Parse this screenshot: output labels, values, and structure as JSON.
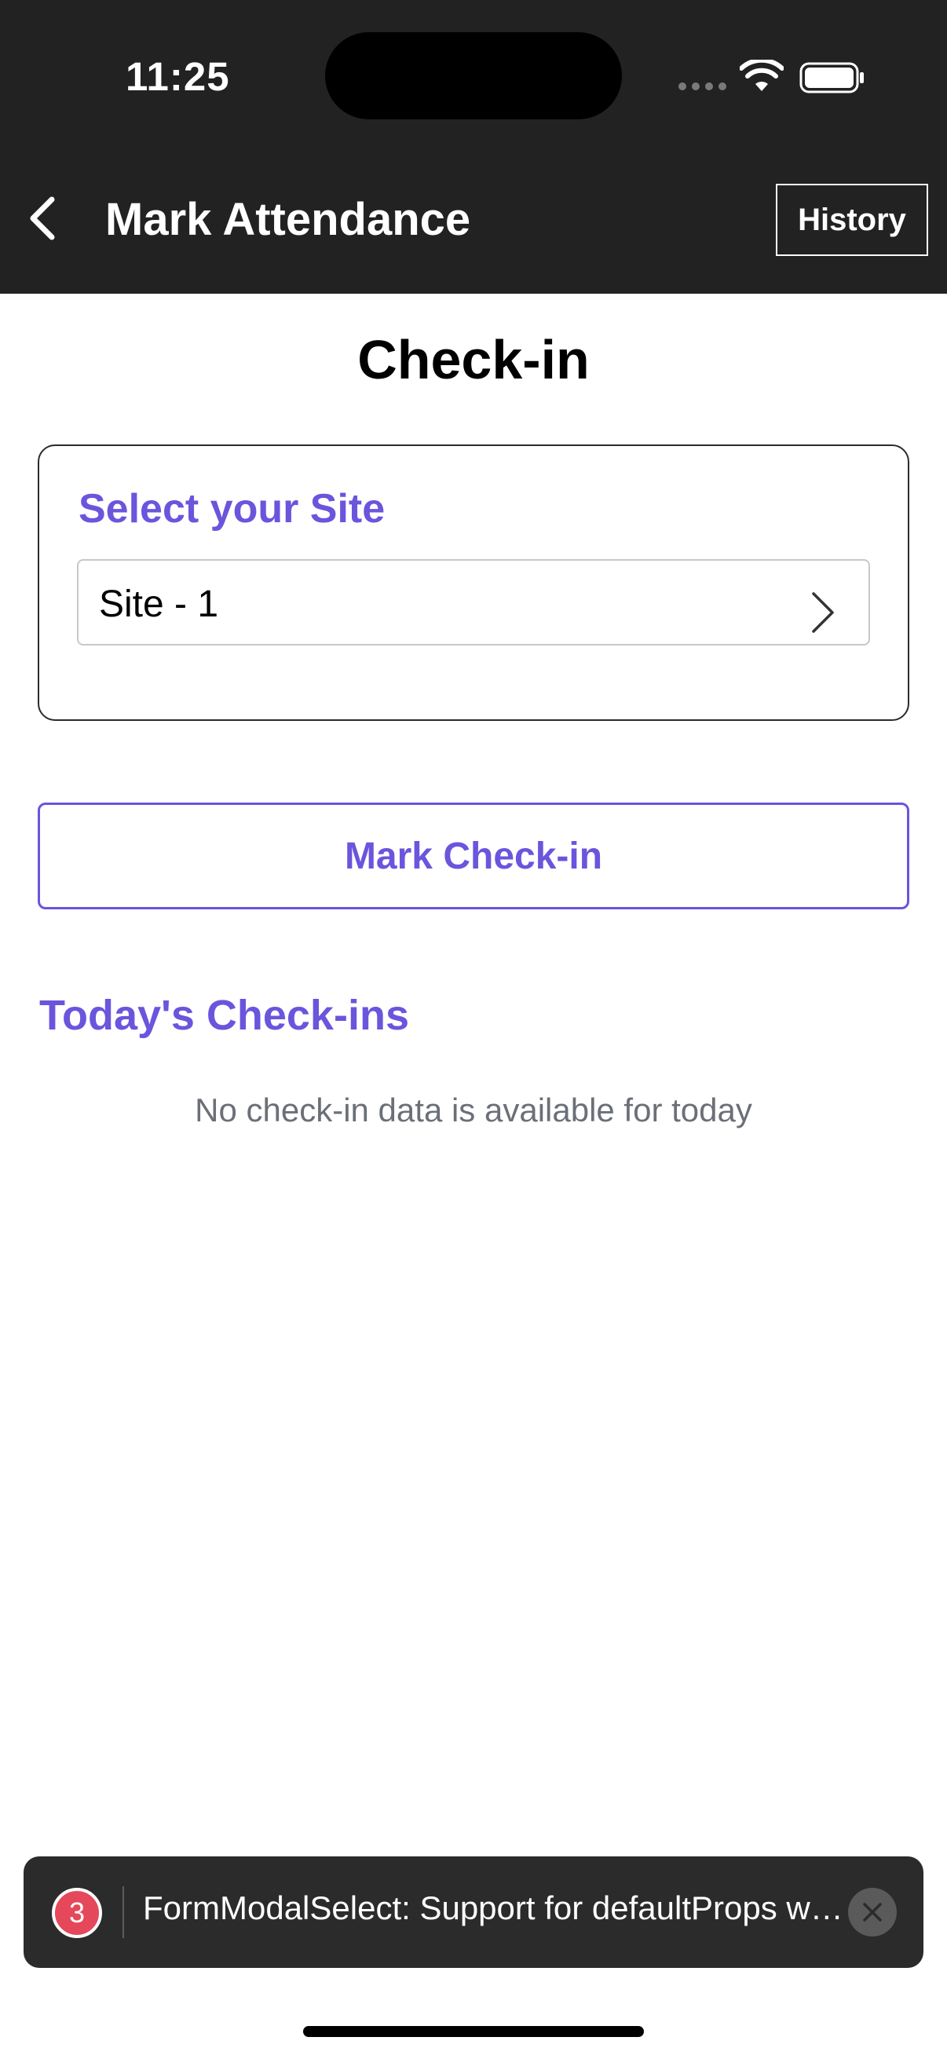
{
  "status_bar": {
    "time": "11:25",
    "icons": [
      "signal-dots-icon",
      "wifi-icon",
      "battery-icon"
    ]
  },
  "nav": {
    "back_icon": "chevron-left-icon",
    "title": "Mark Attendance",
    "history_label": "History"
  },
  "page": {
    "title": "Check-in"
  },
  "site_select": {
    "label": "Select your Site",
    "value": "Site - 1",
    "icon": "chevron-right-icon"
  },
  "actions": {
    "mark_checkin_label": "Mark Check-in"
  },
  "todays_checkins": {
    "title": "Today's Check-ins",
    "empty_message": "No check-in data is available for today"
  },
  "toast": {
    "count": "3",
    "message": "FormModalSelect: Support for defaultProps will be removed from function components in a future major release. Use JavaScript default parameters instead.",
    "close_icon": "close-icon"
  },
  "colors": {
    "accent": "#6a55dd",
    "header_bg": "#222222",
    "toast_bg": "#2b2b2b",
    "badge": "#e5485a",
    "muted_text": "#6b6f78"
  }
}
